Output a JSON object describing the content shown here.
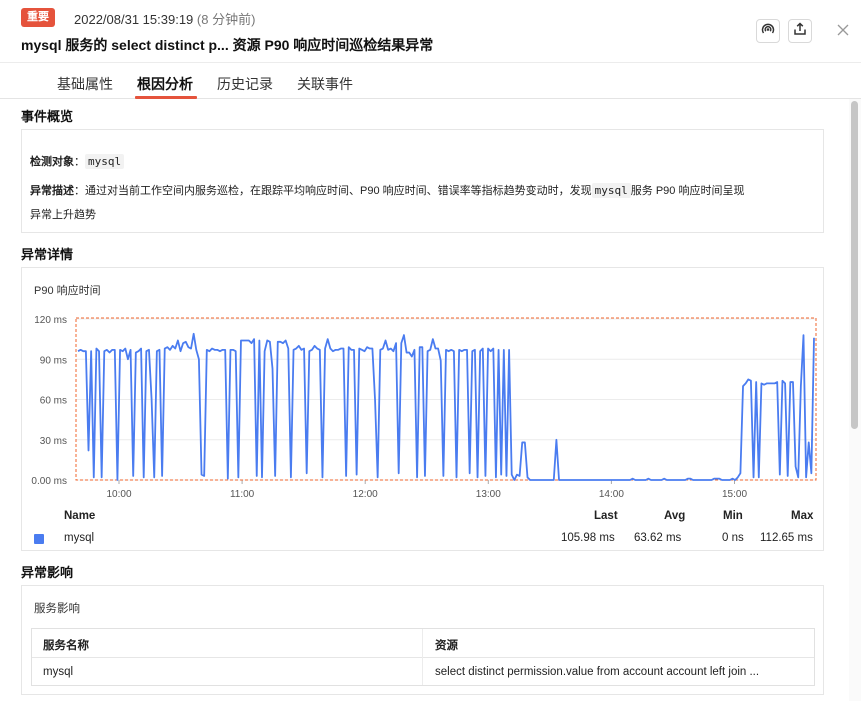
{
  "header": {
    "badge": "重要",
    "timestamp": "2022/08/31 15:39:19",
    "time_ago": "(8 分钟前)",
    "title": "mysql 服务的 select distinct p... 资源 P90 响应时间巡检结果异常"
  },
  "tabs": [
    "基础属性",
    "根因分析",
    "历史记录",
    "关联事件"
  ],
  "active_tab": "根因分析",
  "overview": {
    "heading": "事件概览",
    "target_label": "检测对象",
    "target_value": "mysql",
    "desc_label": "异常描述",
    "desc_pre": "通过对当前工作空间内服务巡检，在跟踪平均响应时间、P90 响应时间、错误率等指标趋势变动时，发现",
    "desc_code": "mysql",
    "desc_post": "服务 P90 响应时间呈现",
    "desc_line2": "异常上升趋势"
  },
  "details": {
    "heading": "异常详情",
    "chart_title": "P90 响应时间"
  },
  "chart_data": {
    "type": "line",
    "title": "P90 响应时间",
    "ylim": [
      0,
      120
    ],
    "y_ticks": [
      "0.00 ms",
      "30 ms",
      "60 ms",
      "90 ms",
      "120 ms"
    ],
    "x_ticks": [
      "10:00",
      "11:00",
      "12:00",
      "13:00",
      "14:00",
      "15:00"
    ],
    "grid": true,
    "series": [
      {
        "name": "mysql",
        "color": "#4a7cf0",
        "values": [
          96,
          97,
          96,
          96,
          22,
          96,
          2,
          98,
          96,
          2,
          96,
          97,
          95,
          97,
          97,
          0,
          97,
          96,
          98,
          90,
          97,
          3,
          95,
          96,
          98,
          2,
          96,
          97,
          60,
          2,
          96,
          97,
          3,
          98,
          99,
          97,
          100,
          98,
          104,
          96,
          102,
          103,
          99,
          98,
          109,
          97,
          90,
          4,
          3,
          97,
          96,
          98,
          97,
          97,
          96,
          97,
          97,
          1,
          97,
          97,
          96,
          2,
          104,
          104,
          104,
          104,
          102,
          105,
          3,
          104,
          2,
          96,
          104,
          103,
          83,
          3,
          103,
          103,
          102,
          104,
          98,
          2,
          97,
          98,
          100,
          97,
          98,
          5,
          96,
          97,
          100,
          98,
          97,
          2,
          98,
          105,
          98,
          96,
          97,
          97,
          98,
          98,
          3,
          99,
          97,
          97,
          4,
          98,
          97,
          96,
          99,
          98,
          98,
          60,
          2,
          97,
          98,
          104,
          97,
          98,
          96,
          102,
          5,
          102,
          108,
          95,
          95,
          92,
          97,
          2,
          99,
          99,
          3,
          96,
          97,
          105,
          98,
          98,
          89,
          3,
          97,
          96,
          97,
          96,
          2,
          97,
          96,
          97,
          97,
          5,
          96,
          97,
          2,
          96,
          98,
          3,
          98,
          96,
          98,
          2,
          97,
          4,
          97,
          3,
          97,
          4,
          0,
          4,
          3,
          28,
          28,
          2,
          0,
          0,
          0,
          0,
          0,
          0,
          0,
          0,
          0,
          0,
          30,
          0,
          0,
          0,
          0,
          0,
          0,
          0,
          0,
          0,
          0,
          0,
          0,
          0,
          0,
          0,
          0,
          0,
          0,
          0,
          0,
          0,
          0,
          0,
          0,
          0,
          0,
          0,
          0,
          1,
          0,
          0,
          0,
          0,
          0,
          1,
          0,
          0,
          0,
          0,
          0,
          1,
          0,
          0,
          0,
          0,
          0,
          0,
          0,
          0,
          1,
          1,
          0,
          0,
          0,
          0,
          0,
          0,
          0,
          0,
          1,
          1,
          1,
          0,
          0,
          0,
          0,
          1,
          0,
          2,
          5,
          70,
          72,
          75,
          74,
          2,
          73,
          2,
          72,
          71,
          72,
          72,
          72,
          72,
          73,
          4,
          74,
          72,
          3,
          73,
          73,
          10,
          2,
          70,
          108,
          2,
          28,
          5,
          106
        ]
      }
    ],
    "legend": {
      "headers": {
        "name": "Name",
        "last": "Last",
        "avg": "Avg",
        "min": "Min",
        "max": "Max"
      },
      "rows": [
        {
          "name": "mysql",
          "last": "105.98 ms",
          "avg": "63.62 ms",
          "min": "0 ns",
          "max": "112.65 ms"
        }
      ]
    }
  },
  "impact": {
    "heading": "异常影响",
    "sub_label": "服务影响",
    "columns": [
      "服务名称",
      "资源"
    ],
    "rows": [
      [
        "mysql",
        "select distinct permission.value from account account left join ..."
      ]
    ]
  }
}
